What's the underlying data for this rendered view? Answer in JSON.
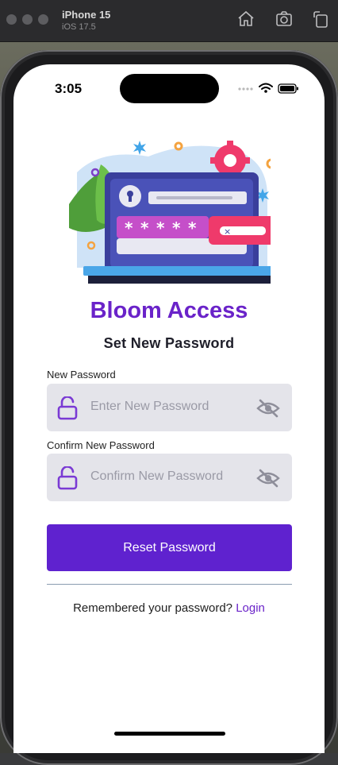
{
  "simulator": {
    "device": "iPhone 15",
    "os": "iOS 17.5"
  },
  "status_bar": {
    "time": "3:05"
  },
  "app": {
    "brand": "Bloom Access",
    "title": "Set New Password",
    "new_password": {
      "label": "New Password",
      "placeholder": "Enter New Password"
    },
    "confirm_password": {
      "label": "Confirm New Password",
      "placeholder": "Confirm New Password"
    },
    "submit_label": "Reset Password",
    "footer_text": "Remembered your password? ",
    "footer_link": "Login"
  },
  "colors": {
    "accent": "#6a23c9",
    "button": "#5f22cf",
    "field_bg": "#e4e4ea"
  },
  "icons": [
    "home-icon",
    "screenshot-icon",
    "rotate-icon",
    "wifi-icon",
    "battery-icon",
    "unlock-icon",
    "eye-off-icon"
  ]
}
